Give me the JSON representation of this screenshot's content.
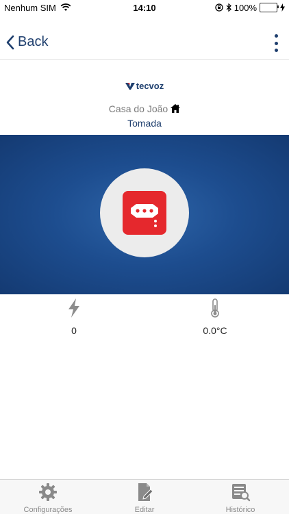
{
  "status_bar": {
    "carrier": "Nenhum SIM",
    "time": "14:10",
    "battery": "100%",
    "battery_level": 1.0
  },
  "nav": {
    "back_label": "Back",
    "back_icon": "chevron-left-icon",
    "more_icon": "vertical-dots-icon"
  },
  "header": {
    "brand": "tecvoz",
    "home_name": "Casa do João",
    "device_type": "Tomada"
  },
  "colors": {
    "primary": "#1f3f6e",
    "hero_blue": "#1d4d8f",
    "device_red": "#e5282d",
    "tab_gray": "#8a8a8a"
  },
  "readings": {
    "power_value": "0",
    "power_icon": "lightning-icon",
    "temperature_value": "0.0°C",
    "temperature_icon": "thermometer-icon"
  },
  "tabs": [
    {
      "label": "Configurações",
      "icon": "gear-icon"
    },
    {
      "label": "Editar",
      "icon": "edit-document-icon"
    },
    {
      "label": "Histórico",
      "icon": "history-search-icon"
    }
  ]
}
